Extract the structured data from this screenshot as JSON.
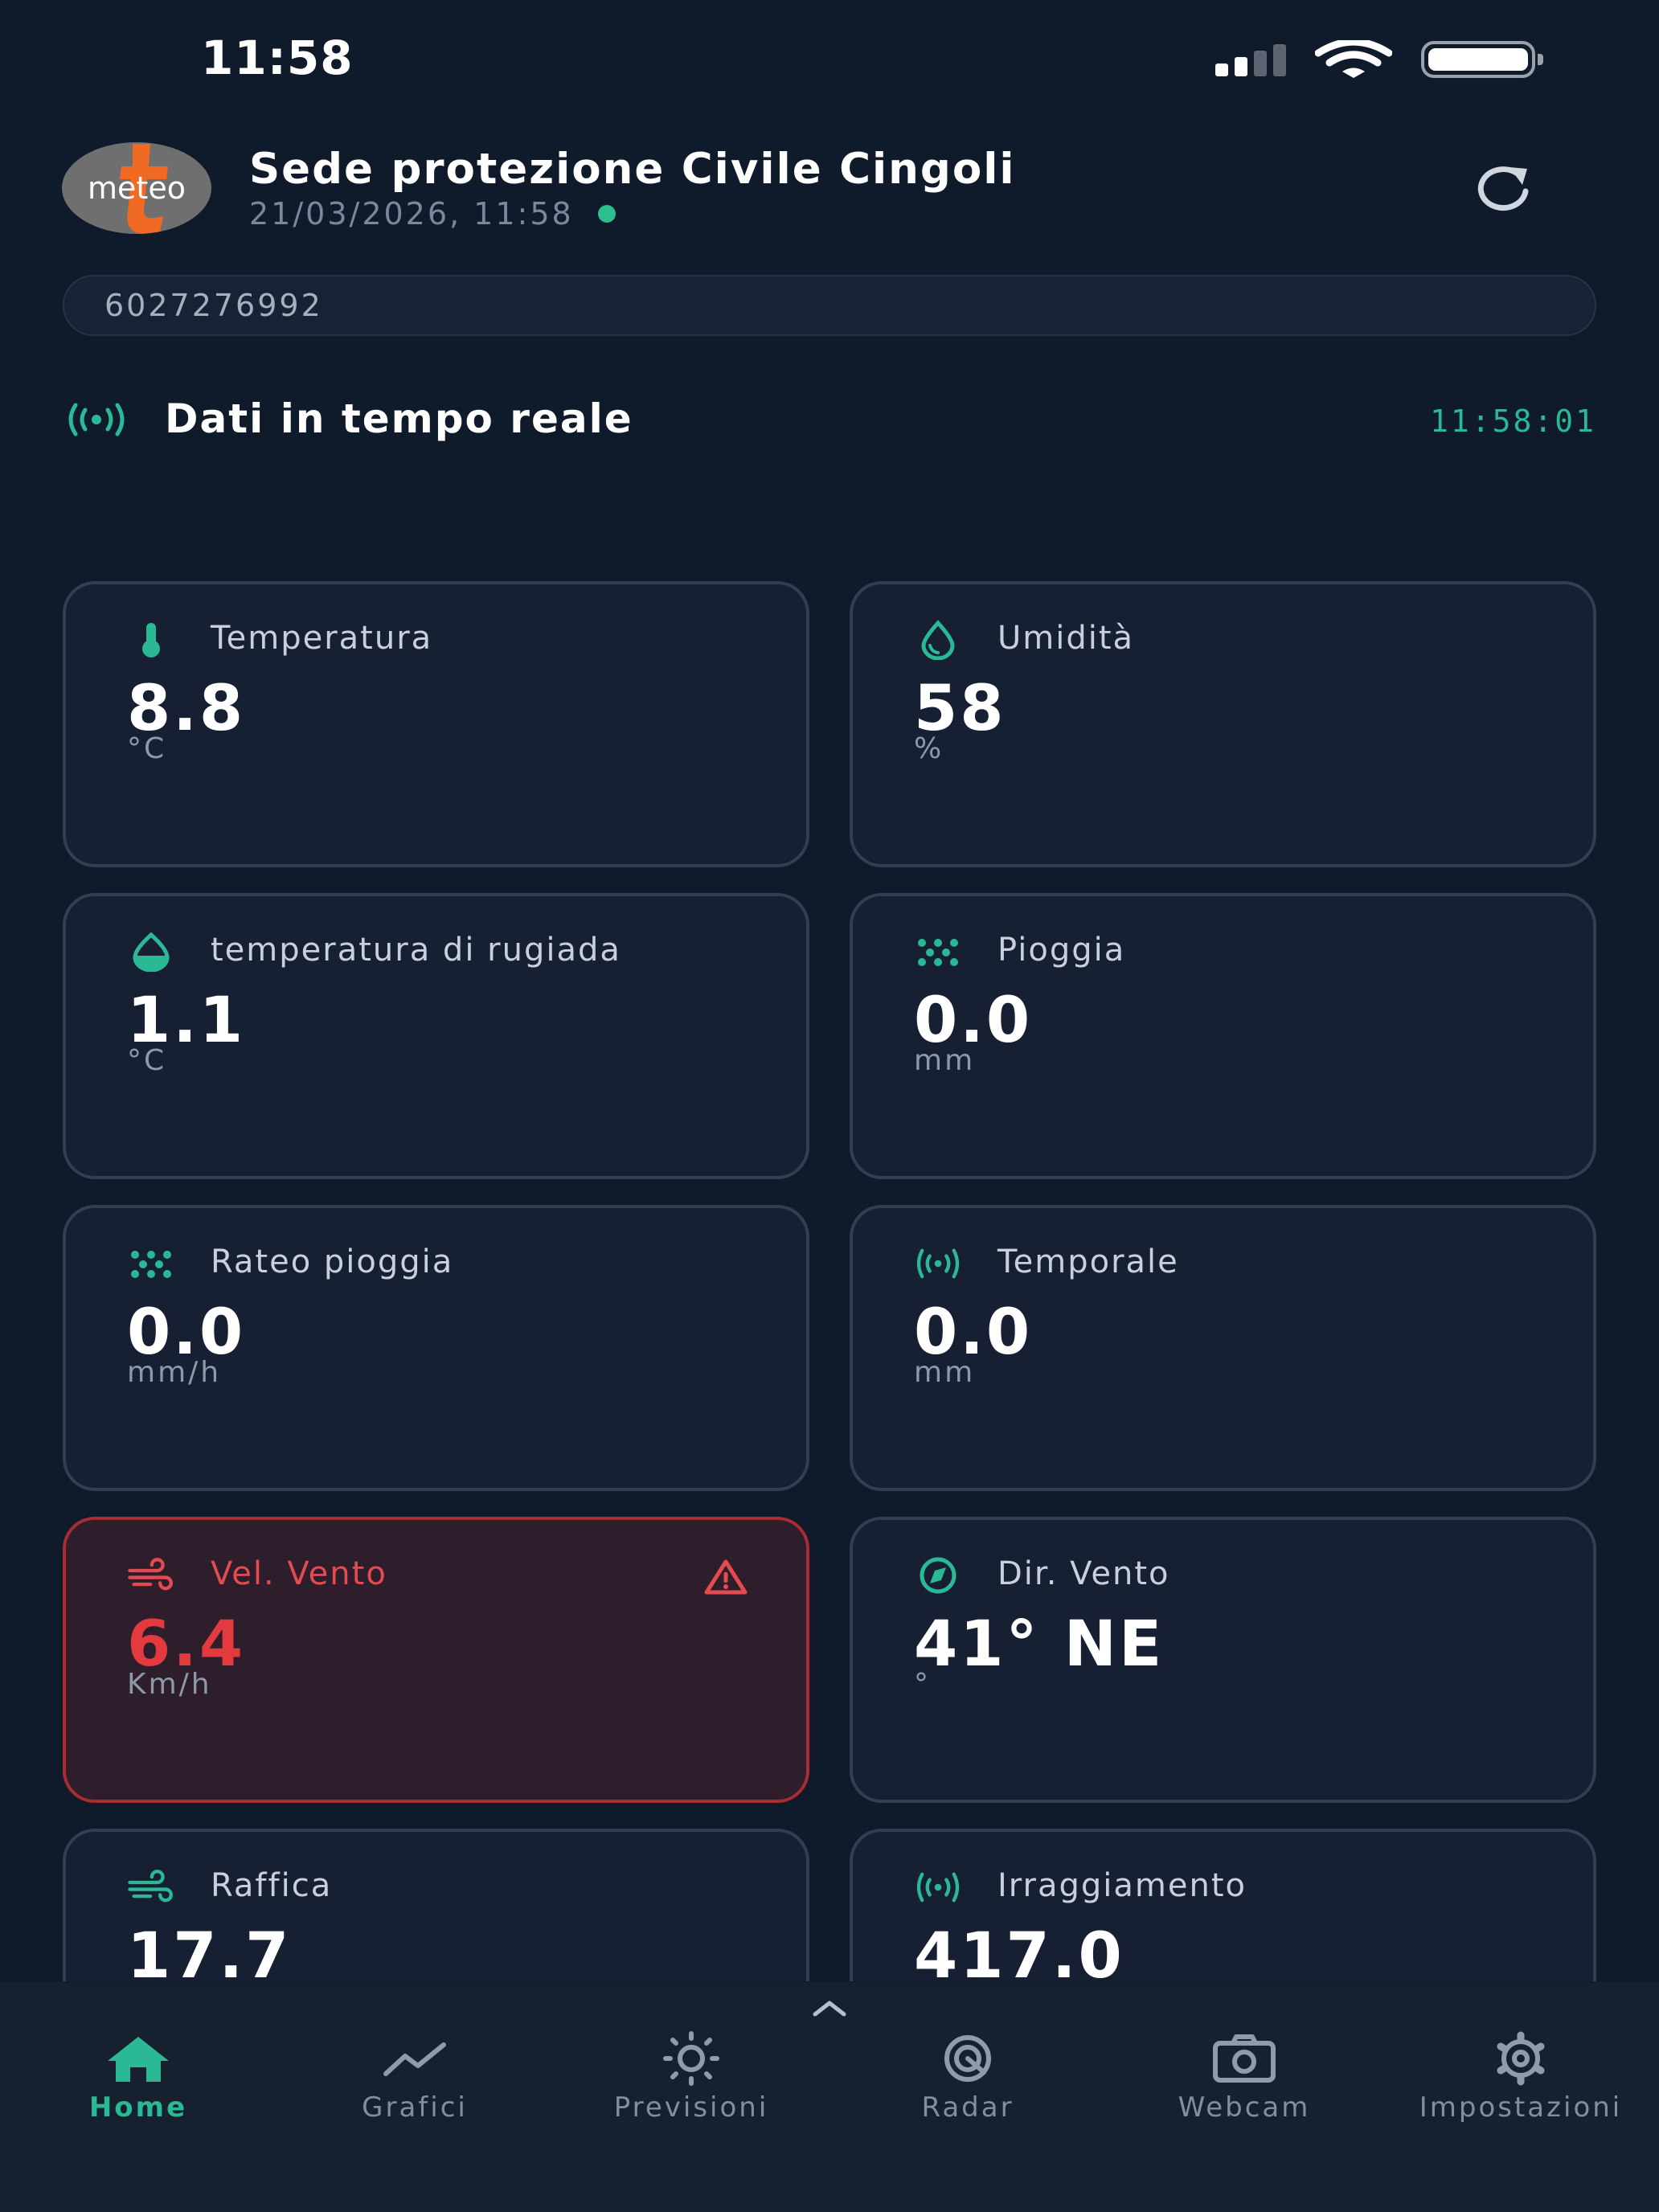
{
  "status_bar": {
    "time": "11:58"
  },
  "header": {
    "logo_text": "meteo",
    "station_name": "Sede protezione Civile Cingoli",
    "datetime": "21/03/2026, 11:58"
  },
  "station_id": {
    "value": "6027276992"
  },
  "realtime": {
    "title": "Dati in tempo reale",
    "time": "11:58:01"
  },
  "cards": [
    {
      "label": "Temperatura",
      "value": "8.8",
      "unit": "°C",
      "icon": "thermometer-icon"
    },
    {
      "label": "Umidità",
      "value": "58",
      "unit": "%",
      "icon": "droplet-icon"
    },
    {
      "label": "temperatura di rugiada",
      "value": "1.1",
      "unit": "°C",
      "icon": "dewpoint-icon"
    },
    {
      "label": "Pioggia",
      "value": "0.0",
      "unit": "mm",
      "icon": "rain-icon"
    },
    {
      "label": "Rateo pioggia",
      "value": "0.0",
      "unit": "mm/h",
      "icon": "rain-icon"
    },
    {
      "label": "Temporale",
      "value": "0.0",
      "unit": "mm",
      "icon": "signal-icon"
    },
    {
      "label": "Vel. Vento",
      "value": "6.4",
      "unit": "Km/h",
      "icon": "wind-icon",
      "alert": true
    },
    {
      "label": "Dir. Vento",
      "value": "41° NE",
      "unit": "°",
      "icon": "compass-icon"
    },
    {
      "label": "Raffica",
      "value": "17.7",
      "unit": "",
      "icon": "wind-icon"
    },
    {
      "label": "Irraggiamento",
      "value": "417.0",
      "unit": "",
      "icon": "signal-icon"
    }
  ],
  "nav": [
    {
      "label": "Home",
      "icon": "home-icon",
      "active": true
    },
    {
      "label": "Grafici",
      "icon": "chart-icon"
    },
    {
      "label": "Previsioni",
      "icon": "sun-icon"
    },
    {
      "label": "Radar",
      "icon": "radar-icon"
    },
    {
      "label": "Webcam",
      "icon": "camera-icon"
    },
    {
      "label": "Impostazioni",
      "icon": "gear-icon"
    }
  ],
  "colors": {
    "background": "#0f1a2a",
    "card": "#172033",
    "accent": "#2bb894",
    "alert": "#e23a3e"
  }
}
